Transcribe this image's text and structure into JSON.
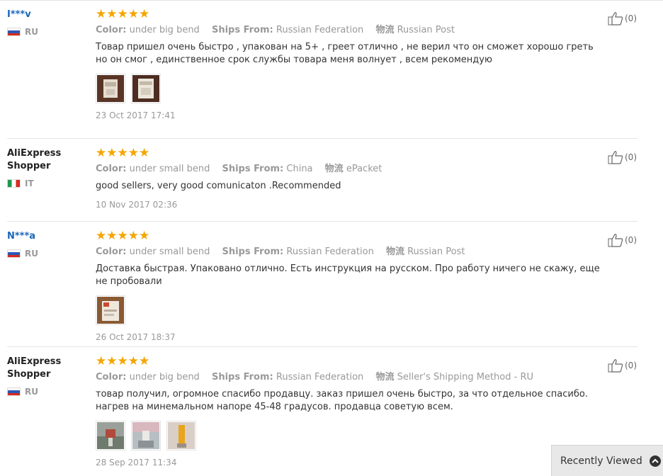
{
  "attr_labels": {
    "color": "Color:",
    "ships_from": "Ships From:",
    "logistics": "物流"
  },
  "stars": "★★★★★",
  "reviews": [
    {
      "user": "I***v",
      "country": "RU",
      "color": "under big bend",
      "ships_from": "Russian Federation",
      "logistics": "Russian Post",
      "text": "Товар пришел очень быстро , упакован на 5+ , греет отлично , не верил что он сможет хорошо греть но он смог , единственное срок службы товара меня волнует , всем рекомендую",
      "date": "23 Oct 2017 17:41",
      "helpful": "(0)"
    },
    {
      "user": "AliExpress Shopper",
      "country": "IT",
      "color": "under small bend",
      "ships_from": "China",
      "logistics": "ePacket",
      "text": "good sellers, very good comunicaton .Recommended",
      "date": "10 Nov 2017 02:36",
      "helpful": "(0)"
    },
    {
      "user": "N***a",
      "country": "RU",
      "color": "under small bend",
      "ships_from": "Russian Federation",
      "logistics": "Russian Post",
      "text": "Доставка быстрая. Упаковано отлично. Есть инструкция на русском. Про работу ничего не скажу, еще не пробовали",
      "date": "26 Oct 2017 18:37",
      "helpful": "(0)"
    },
    {
      "user": "AliExpress Shopper",
      "country": "RU",
      "color": "under big bend",
      "ships_from": "Russian Federation",
      "logistics": "Seller's Shipping Method - RU",
      "text": "товар получил, огромное спасибо продавцу. заказ пришел очень быстро, за что отдельное спасибо. нагрев на минемальном напоре 45-48 градусов. продавца советую всем.",
      "date": "28 Sep 2017 11:34",
      "helpful": "(0)"
    }
  ],
  "recently_viewed": "Recently Viewed",
  "colors": {
    "link": "#1a66b8",
    "star": "#f4a600",
    "muted": "#999999"
  }
}
